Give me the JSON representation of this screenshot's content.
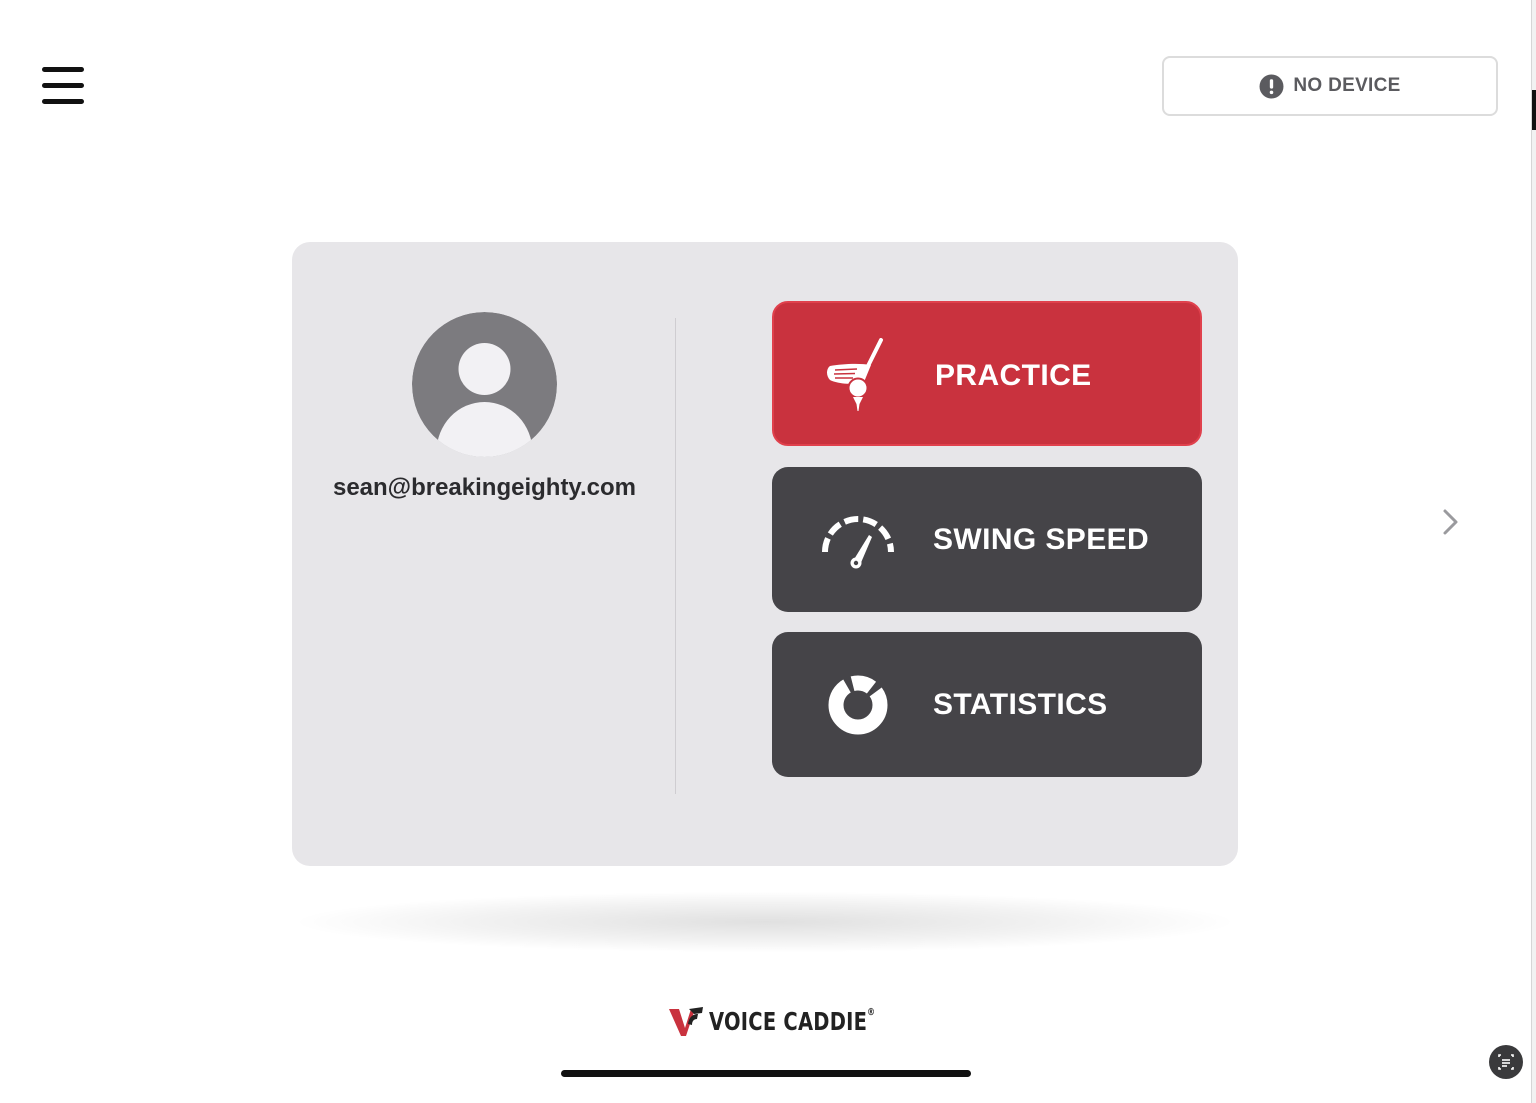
{
  "header": {
    "menu_icon": "hamburger-menu-icon",
    "device_status": {
      "label": "NO DEVICE",
      "icon": "alert-circle-icon"
    }
  },
  "profile": {
    "avatar_icon": "user-avatar-icon",
    "email": "sean@breakingeighty.com"
  },
  "actions": [
    {
      "label": "PRACTICE",
      "icon": "golf-club-icon",
      "color": "#c9323e"
    },
    {
      "label": "SWING SPEED",
      "icon": "speedometer-icon",
      "color": "#454448"
    },
    {
      "label": "STATISTICS",
      "icon": "donut-chart-icon",
      "color": "#454448"
    }
  ],
  "navigation": {
    "next_icon": "chevron-right-icon"
  },
  "brand": {
    "name": "VOICE CADDIE",
    "trademark": "®",
    "accent_color": "#c9323e"
  },
  "system": {
    "assist_icon": "scan-text-icon"
  }
}
